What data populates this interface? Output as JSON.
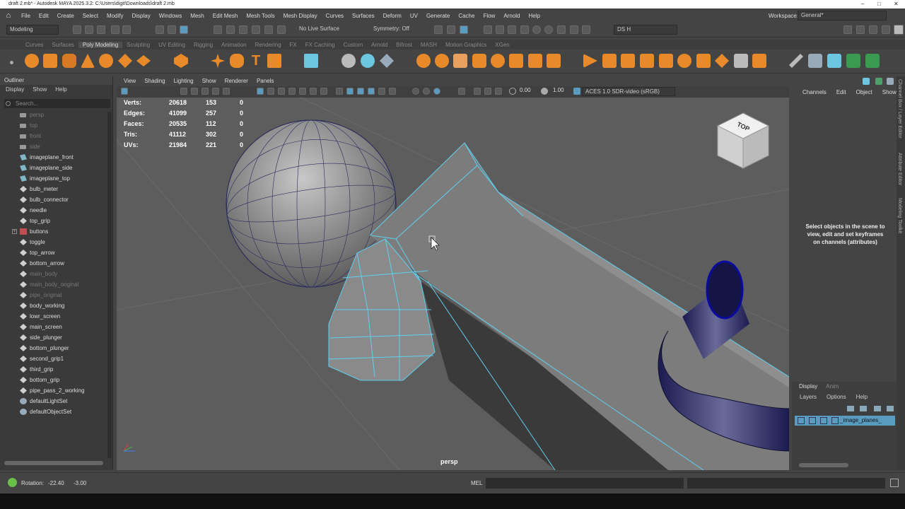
{
  "window": {
    "title": "draft 2.mb* - Autodesk MAYA 2025.3.2: C:\\Users\\digit\\Downloads\\draft 2.mb"
  },
  "menubar": {
    "items": [
      "File",
      "Edit",
      "Create",
      "Select",
      "Modify",
      "Display",
      "Windows",
      "Mesh",
      "Edit Mesh",
      "Mesh Tools",
      "Mesh Display",
      "Curves",
      "Surfaces",
      "Deform",
      "UV",
      "Generate",
      "Cache",
      "Flow",
      "Arnold",
      "Help"
    ],
    "workspace_label": "Workspace:",
    "workspace_value": "General*"
  },
  "statusline": {
    "mode": "Modeling",
    "live_surface": "No Live Surface",
    "symmetry": "Symmetry: Off",
    "user": "DS H"
  },
  "shelf": {
    "tabs": [
      "Curves",
      "Surfaces",
      "Poly Modeling",
      "Sculpting",
      "UV Editing",
      "Rigging",
      "Animation",
      "Rendering",
      "FX",
      "FX Caching",
      "Custom",
      "Arnold",
      "Bifrost",
      "MASH",
      "Motion Graphics",
      "XGen"
    ],
    "active_tab": "Poly Modeling",
    "accent_orange": "#e88a2a"
  },
  "outliner": {
    "title": "Outliner",
    "menu": [
      "Display",
      "Show",
      "Help"
    ],
    "search_placeholder": "Search...",
    "items": [
      {
        "label": "persp",
        "kind": "cam",
        "dim": true
      },
      {
        "label": "top",
        "kind": "cam",
        "dim": true
      },
      {
        "label": "front",
        "kind": "cam",
        "dim": true
      },
      {
        "label": "side",
        "kind": "cam",
        "dim": true
      },
      {
        "label": "imageplane_front",
        "kind": "img",
        "dim": false
      },
      {
        "label": "imageplane_side",
        "kind": "img",
        "dim": false
      },
      {
        "label": "imageplane_top",
        "kind": "img",
        "dim": false
      },
      {
        "label": "bulb_meter",
        "kind": "mesh",
        "dim": false
      },
      {
        "label": "bulb_connector",
        "kind": "mesh",
        "dim": false
      },
      {
        "label": "needle",
        "kind": "mesh",
        "dim": false
      },
      {
        "label": "top_grip",
        "kind": "mesh",
        "dim": false
      },
      {
        "label": "buttons",
        "kind": "grp",
        "dim": false
      },
      {
        "label": "toggle",
        "kind": "mesh",
        "dim": false
      },
      {
        "label": "top_arrow",
        "kind": "mesh",
        "dim": false
      },
      {
        "label": "bottom_arrow",
        "kind": "mesh",
        "dim": false
      },
      {
        "label": "main_body",
        "kind": "mesh",
        "dim": true
      },
      {
        "label": "main_body_original",
        "kind": "mesh",
        "dim": true
      },
      {
        "label": "pipe_original",
        "kind": "mesh",
        "dim": true
      },
      {
        "label": "body_working",
        "kind": "mesh",
        "dim": false
      },
      {
        "label": "lowr_screen",
        "kind": "mesh",
        "dim": false
      },
      {
        "label": "main_screen",
        "kind": "mesh",
        "dim": false
      },
      {
        "label": "side_plunger",
        "kind": "mesh",
        "dim": false
      },
      {
        "label": "bottom_plunger",
        "kind": "mesh",
        "dim": false
      },
      {
        "label": "second_grip1",
        "kind": "mesh",
        "dim": false
      },
      {
        "label": "third_grip",
        "kind": "mesh",
        "dim": false
      },
      {
        "label": "bottom_grip",
        "kind": "mesh",
        "dim": false
      },
      {
        "label": "pipe_pass_2_working",
        "kind": "mesh",
        "dim": false
      },
      {
        "label": "defaultLightSet",
        "kind": "set",
        "dim": false
      },
      {
        "label": "defaultObjectSet",
        "kind": "set",
        "dim": false
      }
    ]
  },
  "viewport": {
    "menu": [
      "View",
      "Shading",
      "Lighting",
      "Show",
      "Renderer",
      "Panels"
    ],
    "field_a": "0.00",
    "field_b": "1.00",
    "colorspace": "ACES 1.0 SDR-video (sRGB)",
    "camera_label": "persp",
    "viewcube_label": "TOP",
    "hud": [
      {
        "label": "Verts:",
        "a": "20618",
        "b": "153",
        "c": "0"
      },
      {
        "label": "Edges:",
        "a": "41099",
        "b": "257",
        "c": "0"
      },
      {
        "label": "Faces:",
        "a": "20535",
        "b": "112",
        "c": "0"
      },
      {
        "label": "Tris:",
        "a": "41112",
        "b": "302",
        "c": "0"
      },
      {
        "label": "UVs:",
        "a": "21984",
        "b": "221",
        "c": "0"
      }
    ],
    "selection_color": "#5fd0f0"
  },
  "channelbox": {
    "menu": [
      "Channels",
      "Edit",
      "Object",
      "Show"
    ],
    "message": "Select objects in the scene to view, edit and set keyframes on channels (attributes)"
  },
  "sidetabs": [
    "Channel Box / Layer Editor",
    "Attribute Editor",
    "Modeling Toolkit"
  ],
  "layers": {
    "tabs": [
      "Display",
      "Anim"
    ],
    "menu": [
      "Layers",
      "Options",
      "Help"
    ],
    "layer_name": "_image_planes_"
  },
  "bottombar": {
    "rotation_label": "Rotation:",
    "rotation_x": "-22.40",
    "rotation_y": "-3.00",
    "mel_label": "MEL"
  }
}
